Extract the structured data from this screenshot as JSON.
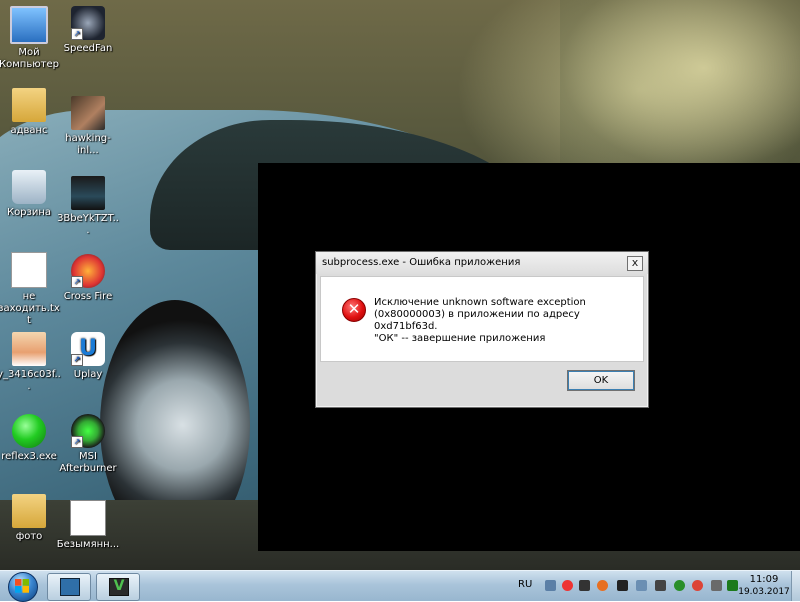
{
  "desktop": {
    "icons": [
      {
        "label": "Мой Компьютер",
        "icon": "computer-icon"
      },
      {
        "label": "SpeedFan",
        "icon": "speedfan-icon"
      },
      {
        "label": "адванс",
        "icon": "folder-icon"
      },
      {
        "label": "hawking-inl...",
        "icon": "photo-icon"
      },
      {
        "label": "Корзина",
        "icon": "recycle-bin-icon"
      },
      {
        "label": "3BbeYkTZT...",
        "icon": "car-image-icon"
      },
      {
        "label": "не заходить.txt",
        "icon": "text-file-icon"
      },
      {
        "label": "Cross Fire",
        "icon": "crossfire-icon"
      },
      {
        "label": "y_3416c03f...",
        "icon": "anime-image-icon"
      },
      {
        "label": "Uplay",
        "icon": "uplay-icon"
      },
      {
        "label": "reflex3.exe",
        "icon": "green-circle-icon"
      },
      {
        "label": "MSI Afterburner",
        "icon": "msi-afterburner-icon"
      },
      {
        "label": "фото",
        "icon": "folder-icon"
      },
      {
        "label": "Безымянн...",
        "icon": "image-file-icon"
      }
    ]
  },
  "dialog": {
    "title": "subprocess.exe - Ошибка приложения",
    "close_label": "x",
    "message": "Исключение unknown software exception (0x80000003) в приложении по адресу 0xd71bf63d.",
    "hint": "\"ОК\" -- завершение приложения",
    "ok_label": "OK",
    "icon": "error-icon"
  },
  "taskbar": {
    "language": "RU",
    "time": "11:09",
    "date": "19.03.2017",
    "tray_icons": [
      "network-icon",
      "chrome-icon",
      "app-icon",
      "security-icon",
      "speedfan-tray-icon",
      "display-icon",
      "volume-icon",
      "flag-icon",
      "chrome-icon",
      "chrome-icon",
      "settings-icon",
      "msi-tray-icon"
    ]
  },
  "colors": {
    "error_red": "#e01010",
    "taskbar": "#a9c4da",
    "dialog_bg": "#dcdcdc"
  }
}
